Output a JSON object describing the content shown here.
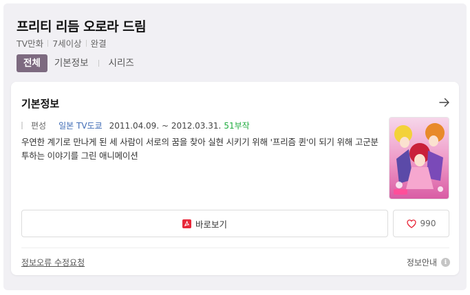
{
  "header": {
    "title": "프리티 리듬 오로라 드림",
    "meta": [
      "TV만화",
      "7세이상",
      "완결"
    ]
  },
  "tabs": [
    {
      "label": "전체",
      "active": true
    },
    {
      "label": "기본정보",
      "active": false
    },
    {
      "label": "시리즈",
      "active": false
    }
  ],
  "card": {
    "title": "기본정보",
    "info": {
      "label": "편성",
      "broadcaster": "일본 TV도쿄",
      "dates": "2011.04.09. ~ 2012.03.31.",
      "episodes": "51부작"
    },
    "description": "우연한 계기로 만나게 된 세 사람이 서로의 꿈을 찾아 실현 시키기 위해 '프리즘 퀸'이 되기 위해 고군분투하는 이야기를 그린 애니메이션",
    "watch_label": "바로보기",
    "like_count": "990",
    "report_label": "정보오류 수정요청",
    "guide_label": "정보안내",
    "info_icon_glyph": "i"
  },
  "icons": {
    "arrow": "arrow-right-icon",
    "watch": "pdf-play-icon",
    "like": "heart-icon",
    "guide": "info-icon"
  },
  "colors": {
    "active_tab": "#7d6a80",
    "episodes": "#1eab3e",
    "broadcaster": "#3f6bb5",
    "watch_icon": "#e8283a",
    "heart": "#e8283a"
  }
}
